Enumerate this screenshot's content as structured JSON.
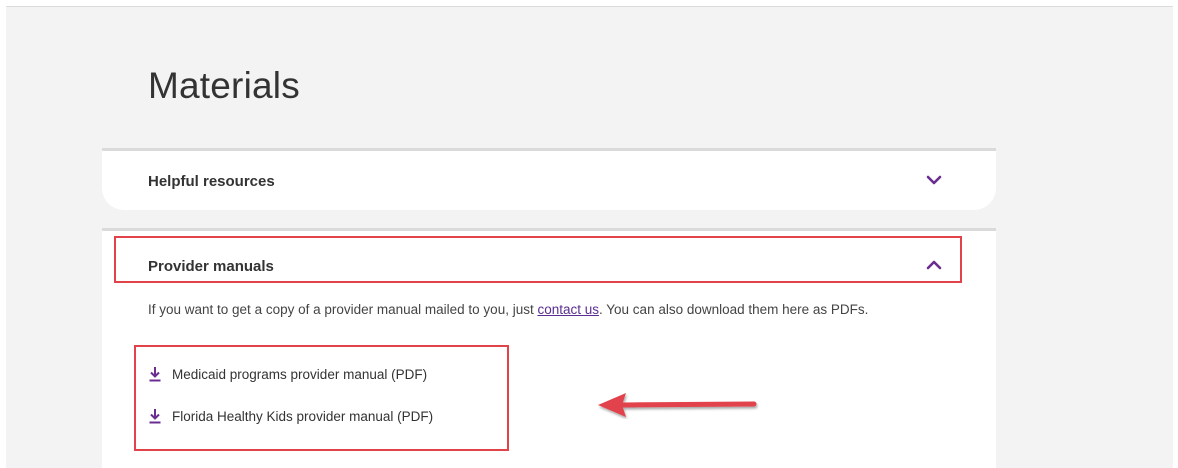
{
  "page": {
    "title": "Materials"
  },
  "accordions": [
    {
      "title": "Helpful resources",
      "expanded": false,
      "chevron_icon": "chevron-down-icon"
    },
    {
      "title": "Provider manuals",
      "expanded": true,
      "chevron_icon": "chevron-up-icon",
      "description_before": "If you want to get a copy of a provider manual mailed to you, just ",
      "description_link": "contact us",
      "description_after": ". You can also download them here as PDFs.",
      "downloads": [
        {
          "label": "Medicaid programs provider manual (PDF)",
          "icon": "download-icon"
        },
        {
          "label": "Florida Healthy Kids provider manual (PDF)",
          "icon": "download-icon"
        }
      ]
    }
  ],
  "colors": {
    "accent": "#6a2c91",
    "annotation": "#e2434b",
    "background": "#f3f3f3"
  }
}
